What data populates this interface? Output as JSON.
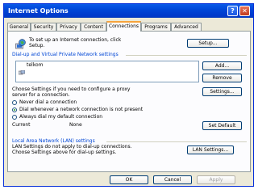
{
  "window": {
    "title": "Internet Options"
  },
  "tabs": [
    "General",
    "Security",
    "Privacy",
    "Content",
    "Connections",
    "Programs",
    "Advanced"
  ],
  "active_tab": "Connections",
  "setup": {
    "text_line1": "To set up an Internet connection, click",
    "text_line2": "Setup.",
    "button": "Setup..."
  },
  "dialup": {
    "group_label": "Dial-up and Virtual Private Network settings",
    "connections": [
      "telkom"
    ],
    "add_button": "Add...",
    "remove_button": "Remove",
    "settings_text_line1": "Choose Settings if you need to configure a proxy",
    "settings_text_line2": "server for a connection.",
    "settings_button": "Settings...",
    "options": [
      {
        "label": "Never dial a connection",
        "selected": false
      },
      {
        "label": "Dial whenever a network connection is not present",
        "selected": true
      },
      {
        "label": "Always dial my default connection",
        "selected": false
      }
    ],
    "current_label": "Current",
    "current_value": "None",
    "set_default_button": "Set Default"
  },
  "lan": {
    "group_label": "Local Area Network (LAN) settings",
    "text_line1": "LAN Settings do not apply to dial-up connections.",
    "text_line2": "Choose Settings above for dial-up settings.",
    "button": "LAN Settings..."
  },
  "footer": {
    "ok": "OK",
    "cancel": "Cancel",
    "apply": "Apply"
  },
  "colors": {
    "titlebar": "#0047d8",
    "group_label": "#0046d5",
    "active_tab_accent": "#f7a33c",
    "dialog_bg": "#ece9d8"
  },
  "icons": {
    "help": "help-icon",
    "close": "close-icon",
    "globe": "globe-computer-icon",
    "connection": "dialup-connection-icon"
  }
}
